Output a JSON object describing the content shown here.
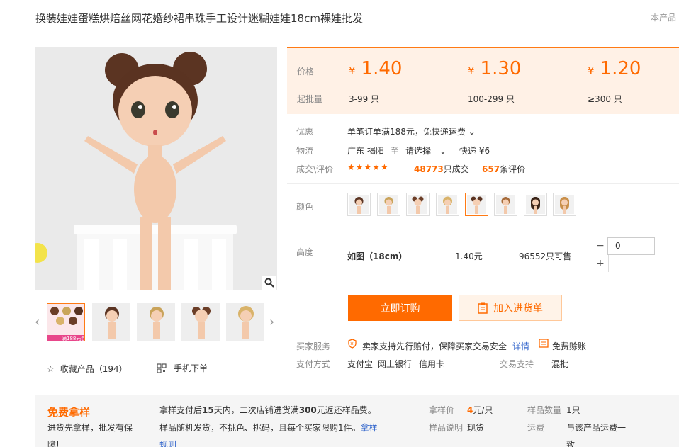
{
  "product": {
    "title": "换装娃娃蛋糕烘焙丝网花婚纱裙串珠手工设计迷糊娃娃18cm裸娃批发",
    "corner_note": "本产品"
  },
  "gallery": {
    "thumb_badge": "满188元包"
  },
  "actions": {
    "favorite_label": "收藏产品",
    "favorite_count": "（194）",
    "mobile_order_label": "手机下单"
  },
  "pricing": {
    "price_label": "价格",
    "moq_label": "起批量",
    "currency": "¥",
    "tiers": [
      {
        "price": "1.40",
        "range": "3-99 只"
      },
      {
        "price": "1.30",
        "range": "100-299 只"
      },
      {
        "price": "1.20",
        "range": "≥300 只"
      }
    ]
  },
  "info": {
    "promo_label": "优惠",
    "promo_value": "单笔订单满188元，免快递运费",
    "logistics_label": "物流",
    "origin": "广东 揭阳",
    "to": "至",
    "select": "请选择",
    "shipping": "快递 ¥6",
    "deals_label": "成交\\评价",
    "stars": "★★★★★",
    "deals_count": "48773",
    "deals_suffix": "只成交",
    "reviews_count": "657",
    "reviews_suffix": "条评价"
  },
  "color": {
    "label": "颜色",
    "selected_index": 4,
    "swatch_count": 8
  },
  "variant": {
    "label": "高度",
    "name": "如图（18cm）",
    "price": "1.40元",
    "stock": "96552只可售",
    "qty": "0"
  },
  "buttons": {
    "buy": "立即订购",
    "cart": "加入进货单"
  },
  "service": {
    "label": "买家服务",
    "text": "卖家支持先行赔付，保障买家交易安全",
    "detail_link": "详情",
    "free_credit": "免费赊账",
    "pay_label": "支付方式",
    "pay_methods": [
      "支付宝",
      "网上银行",
      "信用卡"
    ],
    "trade_label": "交易支持",
    "trade_value": "混批"
  },
  "free_sample": {
    "title": "免费拿样",
    "desc_line1": "进货先拿样，批发有保",
    "desc_line2": "障!",
    "rule_line1_a": "拿样支付后",
    "rule_line1_b": "15",
    "rule_line1_c": "天内，二次店铺进货满",
    "rule_line1_d": "300",
    "rule_line1_e": "元返还样品费。",
    "rule_line2": "样品随机发货，不挑色、挑码，且每个买家限购1件。",
    "rule_link_a": "拿样",
    "rule_link_b": "规则",
    "sample_price_label": "拿样价",
    "sample_price_value": "4",
    "sample_price_unit": "元/只",
    "sample_desc_label": "样品说明",
    "sample_desc_value": "现货",
    "sample_qty_label": "样品数量",
    "sample_qty_value": "1只",
    "freight_label": "运费",
    "freight_value_line1": "与该产品运费一",
    "freight_value_line2": "致"
  },
  "colors": {
    "accent": "#ff6a00",
    "price_bg": "#fff1e6",
    "link": "#3366cc"
  }
}
